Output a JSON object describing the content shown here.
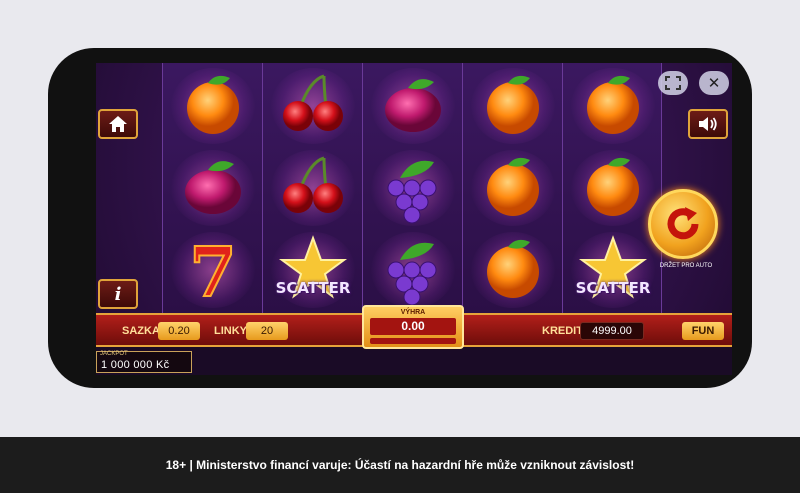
{
  "game": {
    "reels": [
      [
        "orange",
        "plum",
        "seven"
      ],
      [
        "cherries",
        "cherries",
        "scatter"
      ],
      [
        "plum",
        "grapes",
        "grapes"
      ],
      [
        "orange",
        "orange",
        "orange"
      ],
      [
        "orange",
        "orange",
        "scatter"
      ]
    ],
    "scatter_label": "SCATTER",
    "seven_label": "7"
  },
  "controls": {
    "home_icon": "home-icon",
    "info_label": "i",
    "fullscreen_icon": "fullscreen-icon",
    "close_label": "✕",
    "sound_icon": "speaker-icon",
    "autoplay_hint": "DRŽET PRO AUTO"
  },
  "bar": {
    "bet_label": "SAZKA",
    "bet_value": "0.20",
    "lines_label": "LINKY",
    "lines_value": "20",
    "win_label": "VÝHRA",
    "win_value": "0.00",
    "credit_label": "KREDIT",
    "credit_value": "4999.00",
    "mode_label": "FUN"
  },
  "jackpot": {
    "title": "JACKPOT",
    "value": "1 000 000 Kč"
  },
  "footer": {
    "warning": "18+ | Ministerstvo financí varuje: Účastí na hazardní hře může vzniknout závislost!"
  },
  "colors": {
    "accent_gold": "#e6a33a",
    "bar_red": "#b21f1a",
    "bg_purple": "#3a1658"
  }
}
